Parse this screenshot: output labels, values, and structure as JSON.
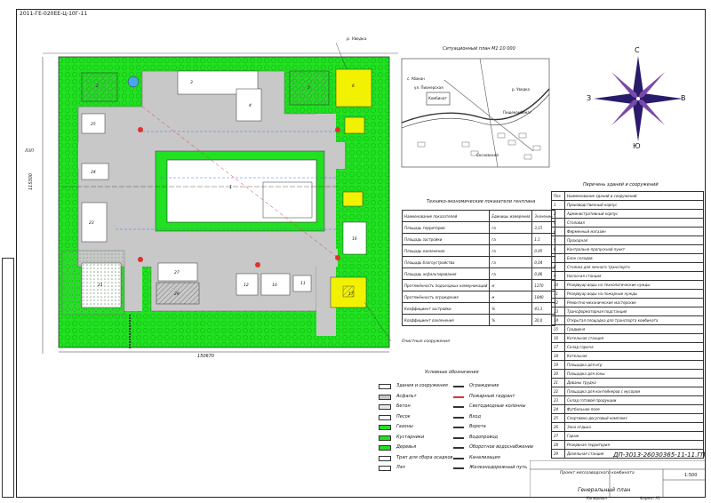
{
  "drawing": {
    "stamp_code": "ДП-3013-26030365-11-11.ГП",
    "sheet_title": "Генеральный план",
    "project_title": "Проект мясозаводского комбината",
    "scale": "1:500",
    "rotated_code": "2011-ГЕ-020ЕЕ-Ц-10Г-11",
    "format": "Формат А1",
    "copy": "Копировал"
  },
  "plan": {
    "dim_horizontal": "150670",
    "dim_vertical": "115300",
    "label_road_top": "р. Уведка",
    "label_lep": "ЛЭП",
    "label_treatment": "Очистные сооружения",
    "building_numbers": [
      "1",
      "2",
      "3",
      "4",
      "5",
      "6",
      "7",
      "8",
      "9",
      "10",
      "11",
      "12",
      "13",
      "14",
      "15",
      "16",
      "17",
      "18",
      "19",
      "20",
      "21",
      "22",
      "23",
      "24",
      "25",
      "26",
      "27",
      "28",
      "29"
    ],
    "gate_labels": [
      "Ворота\nВъезд с Выход",
      "Ворота\nВъезд с Выход"
    ]
  },
  "situation": {
    "title": "Ситуационный план М1:10 000",
    "labels": [
      "р. Уведка",
      "ул. Пионерская",
      "с. Абакан",
      "Комбинат",
      "Пищекомбинат",
      "Сосновский"
    ]
  },
  "compass": {
    "n": "С",
    "s": "Ю",
    "w": "З",
    "e": "В"
  },
  "tep": {
    "title": "Технико-экономические показатели генплана",
    "headers": [
      "Наименование показателей",
      "Единицы измерения",
      "Значение"
    ],
    "rows": [
      [
        "Площадь территории",
        "га",
        "3,15"
      ],
      [
        "Площадь застройки",
        "га",
        "1,1"
      ],
      [
        "Площадь озеленения",
        "га",
        "0,95"
      ],
      [
        "Площадь благоустройства",
        "га",
        "0,04"
      ],
      [
        "Площадь асфальтирования",
        "га",
        "0,86"
      ],
      [
        "Протяжённость подъездных коммуникаций",
        "м",
        "1270"
      ],
      [
        "Протяжённость ограждения",
        "м",
        "1840"
      ],
      [
        "Коэффициент застройки",
        "%",
        "41,3"
      ],
      [
        "Коэффициент озеленения",
        "%",
        "30,0"
      ]
    ]
  },
  "explication": {
    "title": "Перечень зданий и сооружений",
    "headers": [
      "Поз",
      "Наименование зданий и сооружений"
    ],
    "rows": [
      [
        "1",
        "Производственный корпус"
      ],
      [
        "2",
        "Административный корпус"
      ],
      [
        "3",
        "Столовая"
      ],
      [
        "4",
        "Фирменный магазин"
      ],
      [
        "5",
        "Проходная"
      ],
      [
        "6",
        "Контрольно-пропускной пункт"
      ],
      [
        "7",
        "Блок складов"
      ],
      [
        "8",
        "Стоянка для личного транспорта"
      ],
      [
        "9",
        "Насосная станция"
      ],
      [
        "10",
        "Резервуар воды на технологические нужды"
      ],
      [
        "11",
        "Резервуар воды на пожарные нужды"
      ],
      [
        "12",
        "Ремонтно-механические мастерские"
      ],
      [
        "13",
        "Трансформаторная подстанция"
      ],
      [
        "14",
        "Открытая площадка для транспорта комбината"
      ],
      [
        "15",
        "Градирня"
      ],
      [
        "16",
        "Котельная станция"
      ],
      [
        "17",
        "Склад горюча"
      ],
      [
        "18",
        "Котельная"
      ],
      [
        "19",
        "Площадка для игр"
      ],
      [
        "20",
        "Площадка для зоны"
      ],
      [
        "21",
        "Диваны трудна"
      ],
      [
        "22",
        "Площадка для контейнеров с мусором"
      ],
      [
        "23",
        "Склад готовой продукции"
      ],
      [
        "24",
        "Футбольное поле"
      ],
      [
        "25",
        "Спортивно-досуговый комплекс"
      ],
      [
        "26",
        "Зона отдыха"
      ],
      [
        "27",
        "Гараж"
      ],
      [
        "28",
        "Резервная территория"
      ],
      [
        "29",
        "Дизельная станция"
      ]
    ]
  },
  "legend": {
    "title": "Условные обозначения",
    "items_left": [
      "Здания и сооружения",
      "Асфальт",
      "Бетон",
      "Песок",
      "Газоны",
      "Кустарники",
      "Деревья",
      "Трап для сбора осадков",
      "Лэп"
    ],
    "items_right": [
      "Ограждение",
      "Пожарный гидрант",
      "Светодиодные колонны",
      "Вход",
      "Ворота",
      "Водопровод",
      "Оборотное водоснабжение",
      "Канализация",
      "Железнодорожный путь"
    ]
  },
  "colors": {
    "green": "#22e022",
    "gray": "#c8c8c8",
    "yellow": "#f2f200",
    "hatch": "#999999"
  }
}
